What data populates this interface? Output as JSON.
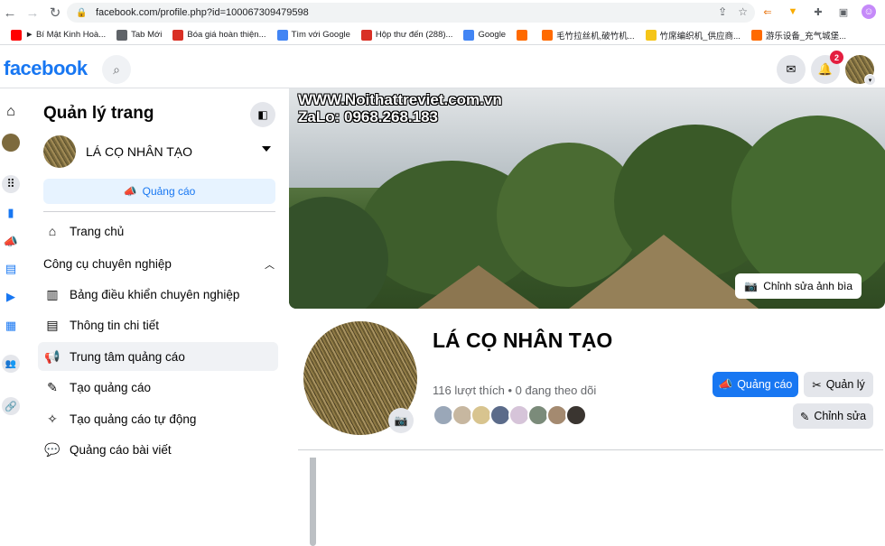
{
  "browser": {
    "url": "facebook.com/profile.php?id=100067309479598",
    "bookmarks": [
      {
        "label": "► Bí Mật Kinh Hoà...",
        "icon": "youtube-icon",
        "color": "#ff0000"
      },
      {
        "label": "Tab Mới",
        "icon": "globe-icon",
        "color": "#5f6368"
      },
      {
        "label": "Bóa giá hoàn thiện...",
        "icon": "gmail-icon",
        "color": "#d93025"
      },
      {
        "label": "Tìm với Google",
        "icon": "google-icon",
        "color": "#4285f4"
      },
      {
        "label": "Hộp thư đến (288)...",
        "icon": "gmail-icon",
        "color": "#d93025"
      },
      {
        "label": "Google",
        "icon": "google-icon",
        "color": "#4285f4"
      },
      {
        "label": "",
        "icon": "alibaba-icon",
        "color": "#ff6a00"
      },
      {
        "label": "毛竹拉丝机,破竹机...",
        "icon": "alibaba-icon",
        "color": "#ff6a00"
      },
      {
        "label": "竹席编织机_供应商...",
        "icon": "weibo-icon",
        "color": "#f5c518"
      },
      {
        "label": "游乐设备_充气城堡...",
        "icon": "alibaba-icon",
        "color": "#ff6a00"
      }
    ]
  },
  "fb": {
    "logo": "facebook",
    "notification_count": "2"
  },
  "panel": {
    "title": "Quản lý trang",
    "page_name": "LÁ CỌ NHÂN TẠO",
    "ad_button": "Quảng cáo",
    "home": "Trang chủ",
    "section": "Công cụ chuyên nghiệp",
    "items": [
      {
        "label": "Bảng điều khiển chuyên nghiệp",
        "icon": "dashboard-icon"
      },
      {
        "label": "Thông tin chi tiết",
        "icon": "insights-icon"
      },
      {
        "label": "Trung tâm quảng cáo",
        "icon": "megaphone-icon"
      },
      {
        "label": "Tạo quảng cáo",
        "icon": "pencil-icon"
      },
      {
        "label": "Tạo quảng cáo tự động",
        "icon": "magic-wand-icon"
      },
      {
        "label": "Quảng cáo bài viết",
        "icon": "chat-bubble-icon"
      }
    ]
  },
  "cover": {
    "watermark_line1": "WWW.Noithattreviet.com.vn",
    "watermark_line2": "ZaLo: 0968.268.183",
    "edit_label": "Chỉnh sửa ảnh bìa"
  },
  "profile": {
    "name": "LÁ CỌ NHÂN TẠO",
    "stats": "116 lượt thích • 0 đang theo dõi",
    "btn_ads": "Quảng cáo",
    "btn_manage": "Quản lý",
    "btn_edit": "Chỉnh sửa"
  }
}
